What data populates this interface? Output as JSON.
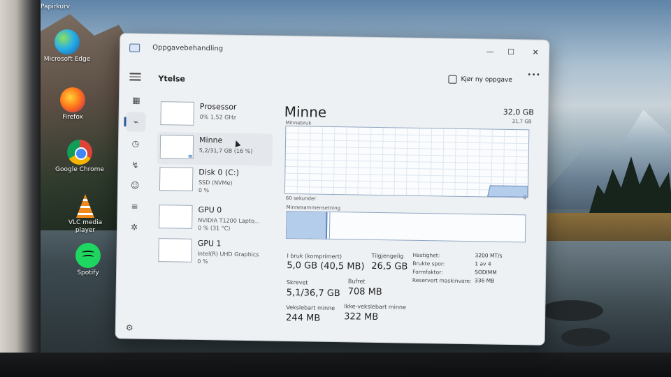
{
  "desktop": {
    "top_label": "Papirkurv",
    "icons": [
      {
        "name": "Microsoft Edge",
        "label": "Microsoft\nEdge",
        "icon": "edge-icon",
        "color": "#1a9be0"
      },
      {
        "name": "Firefox",
        "label": "Firefox",
        "icon": "firefox-icon",
        "color": "#e8692a"
      },
      {
        "name": "Google Chrome",
        "label": "Google\nChrome",
        "icon": "chrome-icon",
        "color": "#3c8c43"
      },
      {
        "name": "VLC media player",
        "label": "VLC media\nplayer",
        "icon": "vlc-cone-icon",
        "color": "#f08a1c"
      },
      {
        "name": "Spotify",
        "label": "Spotify",
        "icon": "spotify-icon",
        "color": "#1ed760"
      }
    ]
  },
  "window": {
    "title": "Oppgavebehandling",
    "page": "Ytelse",
    "run_task": "Kjør ny oppgave",
    "controls": {
      "minimize": "—",
      "maximize": "☐",
      "close": "✕"
    }
  },
  "nav_icons": [
    "menu-icon",
    "processes-icon",
    "performance-icon",
    "app-history-icon",
    "startup-apps-icon",
    "users-icon",
    "details-icon",
    "services-icon"
  ],
  "resources": [
    {
      "name": "Prosessor",
      "sub": "0% 1,52 GHz",
      "sub2": ""
    },
    {
      "name": "Minne",
      "sub": "5,2/31,7 GB (16 %)",
      "sub2": ""
    },
    {
      "name": "Disk 0 (C:)",
      "sub": "SSD (NVMe)",
      "sub2": "0 %"
    },
    {
      "name": "GPU 0",
      "sub": "NVIDIA T1200 Lapto...",
      "sub2": "0 % (31 °C)"
    },
    {
      "name": "GPU 1",
      "sub": "Intel(R) UHD Graphics",
      "sub2": "0 %"
    }
  ],
  "memory": {
    "title": "Minne",
    "total": "32,0 GB",
    "usage_label": "Minnebruk",
    "usage_max": "31,7 GB",
    "time_label": "60 sekunder",
    "time_end": "0",
    "composition_label": "Minnesammensetning",
    "composition_used_fraction": 0.163,
    "composition_modified_fraction": 0.18,
    "stats": {
      "in_use_label": "I bruk (komprimert)",
      "in_use": "5,0 GB (40,5 MB)",
      "available_label": "Tilgjengelig",
      "available": "26,5 GB",
      "committed_label": "Skrevet",
      "committed": "5,1/36,7 GB",
      "cached_label": "Bufret",
      "cached": "708 MB",
      "paged_label": "Vekslebart minne",
      "paged": "244 MB",
      "nonpaged_label": "Ikke-vekslebart minne",
      "nonpaged": "322 MB"
    },
    "props": [
      {
        "label": "Hastighet:",
        "value": "3200 MT/s"
      },
      {
        "label": "Brukte spor:",
        "value": "1 av 4"
      },
      {
        "label": "Formfaktor:",
        "value": "SODIMM"
      },
      {
        "label": "Reservert maskinvare:",
        "value": "336 MB"
      }
    ]
  },
  "colors": {
    "accent": "#2c5aa0",
    "chart_line": "#5e86bf",
    "chart_fill": "#b4cdea"
  }
}
